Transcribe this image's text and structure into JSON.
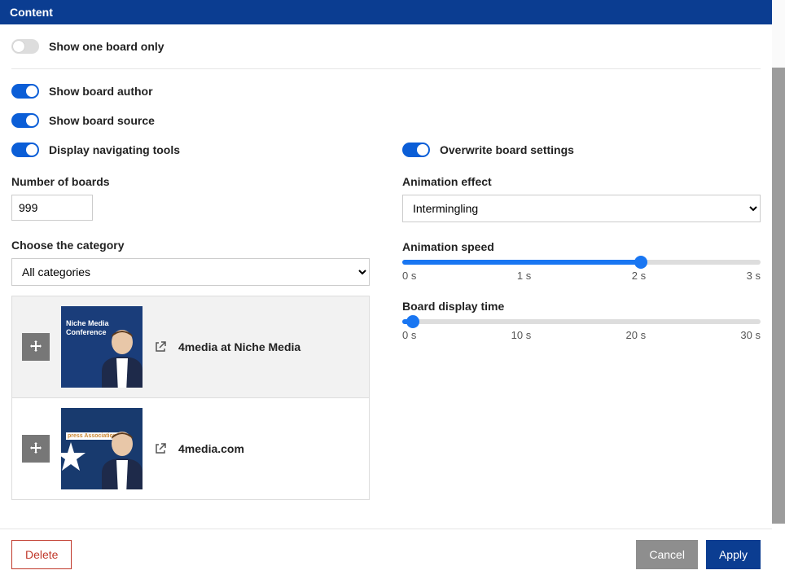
{
  "header": {
    "title": "Content"
  },
  "toggles": {
    "show_one_board": {
      "label": "Show one board only",
      "on": false
    },
    "show_author": {
      "label": "Show board author",
      "on": true
    },
    "show_source": {
      "label": "Show board source",
      "on": true
    },
    "nav_tools": {
      "label": "Display navigating tools",
      "on": true
    },
    "overwrite": {
      "label": "Overwrite board settings",
      "on": true
    }
  },
  "num_boards": {
    "label": "Number of boards",
    "value": "999"
  },
  "category": {
    "label": "Choose the category",
    "selected": "All categories"
  },
  "boards": [
    {
      "title": "4media at Niche Media",
      "thumb_line1": "Niche Media",
      "thumb_line2": "Conference"
    },
    {
      "title": "4media.com",
      "thumb_line1": "",
      "thumb_line2": "press Association"
    }
  ],
  "animation_effect": {
    "label": "Animation effect",
    "selected": "Intermingling"
  },
  "animation_speed": {
    "label": "Animation speed",
    "value_fraction": 0.666,
    "labels": [
      "0 s",
      "1 s",
      "2 s",
      "3 s"
    ]
  },
  "display_time": {
    "label": "Board display time",
    "value_fraction": 0.03,
    "labels": [
      "0 s",
      "10 s",
      "20 s",
      "30 s"
    ]
  },
  "footer": {
    "delete": "Delete",
    "cancel": "Cancel",
    "apply": "Apply"
  }
}
